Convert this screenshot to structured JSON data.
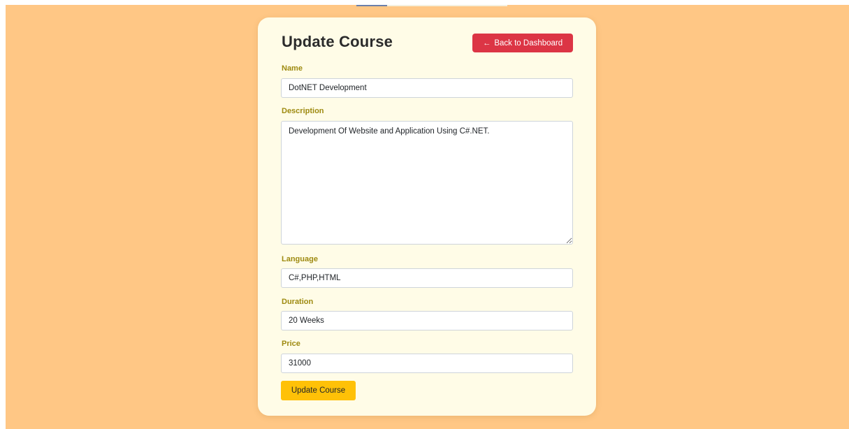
{
  "form": {
    "title": "Update Course",
    "back_button": {
      "arrow": "←",
      "label": "Back to Dashboard"
    },
    "fields": {
      "name": {
        "label": "Name",
        "value": "DotNET Development"
      },
      "description": {
        "label": "Description",
        "value": "Development Of Website and Application Using C#.NET."
      },
      "language": {
        "label": "Language",
        "value": "C#,PHP,HTML"
      },
      "duration": {
        "label": "Duration",
        "value": "20 Weeks"
      },
      "price": {
        "label": "Price",
        "value": "31000"
      }
    },
    "submit_label": "Update Course"
  },
  "colors": {
    "page_background": "#ffc785",
    "card_background": "#fffce7",
    "label_color": "#9e8a10",
    "back_button": "#dc3545",
    "submit_button": "#ffc107"
  }
}
